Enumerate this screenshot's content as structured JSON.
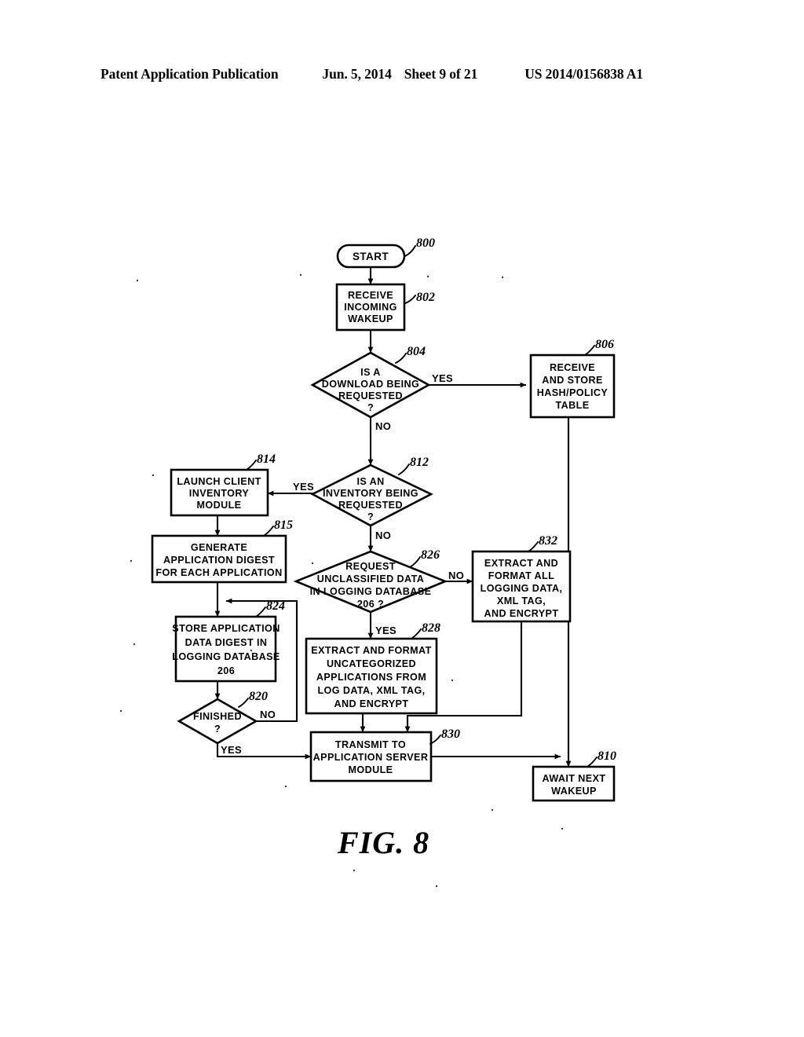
{
  "header": {
    "publication": "Patent Application Publication",
    "date": "Jun. 5, 2014",
    "sheet": "Sheet 9 of 21",
    "patent_number": "US 2014/0156838 A1"
  },
  "figure": {
    "caption": "FIG.  8",
    "type": "flowchart"
  },
  "nodes": {
    "start": {
      "ref": "800",
      "shape": "terminator",
      "lines": [
        "START"
      ]
    },
    "receive_wakeup": {
      "ref": "802",
      "shape": "process",
      "lines": [
        "RECEIVE",
        "INCOMING",
        "WAKEUP"
      ]
    },
    "download_requested": {
      "ref": "804",
      "shape": "decision",
      "lines": [
        "IS A",
        "DOWNLOAD  BEING",
        "REQUESTED",
        "?"
      ]
    },
    "receive_store_hash": {
      "ref": "806",
      "shape": "process",
      "lines": [
        "RECEIVE",
        "AND  STORE",
        "HASH/POLICY",
        "TABLE"
      ]
    },
    "inventory_requested": {
      "ref": "812",
      "shape": "decision",
      "lines": [
        "IS AN",
        "INVENTORY  BEING",
        "REQUESTED",
        "?"
      ]
    },
    "launch_client_inventory": {
      "ref": "814",
      "shape": "process",
      "lines": [
        "LAUNCH  CLIENT",
        "INVENTORY",
        "MODULE"
      ]
    },
    "generate_digest": {
      "ref": "815",
      "shape": "process",
      "lines": [
        "GENERATE",
        "APPLICATION  DIGEST",
        "FOR  EACH  APPLICATION"
      ]
    },
    "store_digest": {
      "ref": "824",
      "shape": "process",
      "lines": [
        "STORE  APPLICATION",
        "DATA  DIGEST  IN",
        "LOGGING  DATABASE",
        "206"
      ]
    },
    "finished": {
      "ref": "820",
      "shape": "decision",
      "lines": [
        "FINISHED",
        "?"
      ]
    },
    "request_unclassified": {
      "ref": "826",
      "shape": "decision",
      "lines": [
        "REQUEST",
        "UNCLASSIFIED  DATA",
        "IN  LOGGING  DATABASE",
        "206  ?"
      ]
    },
    "extract_all_logging": {
      "ref": "832",
      "shape": "process",
      "lines": [
        "EXTRACT  AND",
        "FORMAT  ALL",
        "LOGGING  DATA,",
        "XML  TAG,",
        "AND  ENCRYPT"
      ]
    },
    "extract_uncategorized": {
      "ref": "828",
      "shape": "process",
      "lines": [
        "EXTRACT  AND  FORMAT",
        "UNCATEGORIZED",
        "APPLICATIONS  FROM",
        "LOG  DATA,  XML  TAG,",
        "AND  ENCRYPT"
      ]
    },
    "transmit": {
      "ref": "830",
      "shape": "process",
      "lines": [
        "TRANSMIT  TO",
        "APPLICATION  SERVER",
        "MODULE"
      ]
    },
    "await_wakeup": {
      "ref": "810",
      "shape": "process",
      "lines": [
        "AWAIT  NEXT",
        "WAKEUP"
      ]
    }
  },
  "edge_labels": {
    "download_yes": "YES",
    "download_no": "NO",
    "inventory_yes": "YES",
    "inventory_no": "NO",
    "finished_no": "NO",
    "finished_yes": "YES",
    "unclassified_no": "NO",
    "unclassified_yes": "YES"
  },
  "colors": {
    "ink": "#000000",
    "paper": "#ffffff"
  }
}
